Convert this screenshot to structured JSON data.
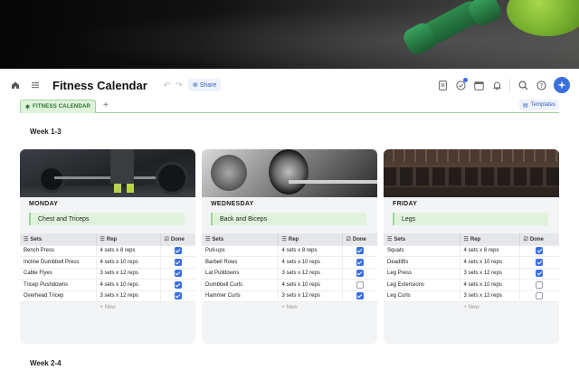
{
  "header": {
    "title": "Fitness Calendar",
    "share_label": "Share"
  },
  "tabs": {
    "active_label": "FITNESS CALENDAR",
    "add_label": "+",
    "templates_label": "Templates"
  },
  "sections": [
    "Week 1-3",
    "Week 2-4"
  ],
  "table_headers": {
    "sets": "Sets",
    "rep": "Rep",
    "done": "Done"
  },
  "new_row_label": "New",
  "days": [
    {
      "day": "MONDAY",
      "focus": "Chest and Triceps",
      "rows": [
        {
          "set": "Bench Press",
          "rep": "4 sets x 8 reps",
          "done": true
        },
        {
          "set": "Incline Dumbbell Press",
          "rep": "4 sets x 10 reps",
          "done": true
        },
        {
          "set": "Cable Flyes",
          "rep": "3 sets x 12 reps",
          "done": true
        },
        {
          "set": "Tricep Pushdowns",
          "rep": "4 sets x 10 reps",
          "done": true
        },
        {
          "set": "Overhead Tricep",
          "rep": "3 sets x 12 reps",
          "done": true
        }
      ]
    },
    {
      "day": "WEDNESDAY",
      "focus": "Back and Biceps",
      "rows": [
        {
          "set": "Pull-ups",
          "rep": "4 sets x 8 reps",
          "done": true
        },
        {
          "set": "Barbell Rows",
          "rep": "4 sets x 10 reps",
          "done": true
        },
        {
          "set": "Lat Pulldowns",
          "rep": "3 sets x 12 reps",
          "done": true
        },
        {
          "set": "Dumbbell Curls",
          "rep": "4 sets x 10 reps",
          "done": false
        },
        {
          "set": "Hammer Curls",
          "rep": "3 sets x 12 reps",
          "done": true
        }
      ]
    },
    {
      "day": "FRIDAY",
      "focus": "Legs",
      "rows": [
        {
          "set": "Squats",
          "rep": "4 sets x 8 reps",
          "done": true
        },
        {
          "set": "Deadlifts",
          "rep": "4 sets x 10 reps",
          "done": true
        },
        {
          "set": "Leg Press",
          "rep": "3 sets x 12 reps",
          "done": true
        },
        {
          "set": "Leg Extensions",
          "rep": "4 sets x 10 reps",
          "done": false
        },
        {
          "set": "Leg Curls",
          "rep": "3 sets x 12 reps",
          "done": false
        }
      ]
    }
  ],
  "icons": {
    "toolbar_left": [
      "home-icon",
      "menu-icon"
    ],
    "toolbar_right": [
      "document-icon",
      "check-circle-icon",
      "calendar-icon",
      "bell-icon",
      "search-icon",
      "help-icon",
      "ai-sparkle-icon"
    ]
  },
  "colors": {
    "accent": "#3b6fe0",
    "tab_green": "#dff3dc",
    "focus_green": "#dff3dc"
  }
}
